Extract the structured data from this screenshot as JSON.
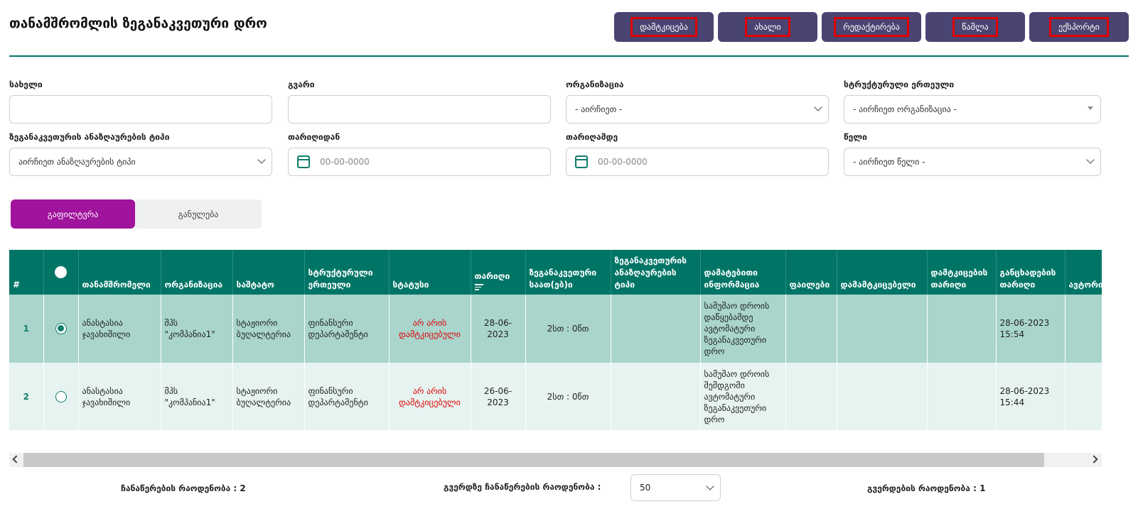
{
  "page": {
    "title": "თანამშრომლის ზეგანაკვეთური დრო"
  },
  "actions": {
    "approve": "დამტკიცება",
    "new": "ახალი",
    "edit": "რედაქტირება",
    "delete": "წაშლა",
    "export": "ექსპორტი"
  },
  "filters": {
    "first_name": {
      "label": "სახელი",
      "value": ""
    },
    "last_name": {
      "label": "გვარი",
      "value": ""
    },
    "organization": {
      "label": "ორგანიზაცია",
      "value": "- აირჩიეთ -"
    },
    "unit": {
      "label": "სტრუქტურული ერთეული",
      "value": "- აირჩიეთ ორგანიზაცია -"
    },
    "comp_type": {
      "label": "ზეგანაკვეთურის ანაზღაურების ტიპი",
      "value": "აირჩიეთ ანაზღაურების ტიპი"
    },
    "date_from": {
      "label": "თარიღიდან",
      "placeholder": "00-00-0000"
    },
    "date_to": {
      "label": "თარიღამდე",
      "placeholder": "00-00-0000"
    },
    "year": {
      "label": "წელი",
      "value": "- აირჩიეთ წელი -"
    }
  },
  "buttons": {
    "filter": "გაფილტვრა",
    "reset": "განულება"
  },
  "table": {
    "headers": {
      "num": "#",
      "employee": "თანამშრომელი",
      "organization": "ორგანიზაცია",
      "position": "საშტატო",
      "unit": "სტრუქტურული ერთეული",
      "status": "სტატუსი",
      "date": "თარიღი",
      "hours": "ზეგანაკვეთური საათ(ებ)ი",
      "comp_type": "ზეგანაკვეთურის ანაზღაურების ტიპი",
      "info": "დამატებითი ინფორმაცია",
      "files": "ფაილები",
      "approver": "დამამტკიცებელი",
      "approve_date": "დამტკიცების თარიღი",
      "app_date": "განცხადების თარიღი",
      "author": "ავტორი"
    },
    "rows": [
      {
        "num": "1",
        "selected": true,
        "employee": "ანასტასია ჯავახიშილი",
        "organization": "შპს \"კომპანია1\"",
        "position": "სტაჟიორი ბუღალტერია",
        "unit": "ფინანსური დეპარტამენტი",
        "status": "არ არის დამტკიცებული",
        "date": "28-06-2023",
        "hours": "2სთ : 0წთ",
        "comp_type": "",
        "info": "სამუშაო დროის დაწყებამდე ავტომატური ზეგანაკვეთური დრო",
        "files": "",
        "approver": "",
        "approve_date": "",
        "app_date": "28-06-2023 15:54",
        "author": ""
      },
      {
        "num": "2",
        "selected": false,
        "employee": "ანასტასია ჯავახიშილი",
        "organization": "შპს \"კომპანია1\"",
        "position": "სტაჟიორი ბუღალტერია",
        "unit": "ფინანსური დეპარტამენტი",
        "status": "არ არის დამტკიცებული",
        "date": "26-06-2023",
        "hours": "2სთ : 0წთ",
        "comp_type": "",
        "info": "სამუშაო დროის შემდგომი ავტომატური ზეგანაკვეთური დრო",
        "files": "",
        "approver": "",
        "approve_date": "",
        "app_date": "28-06-2023 15:44",
        "author": ""
      }
    ]
  },
  "footer": {
    "records_count": "ჩანაწერების რაოდენობა : 2",
    "per_page_label": "გვერდზე ჩანაწერების რაოდენობა :",
    "per_page_value": "50",
    "pages_count": "გვერდების რაოდენობა : 1"
  }
}
